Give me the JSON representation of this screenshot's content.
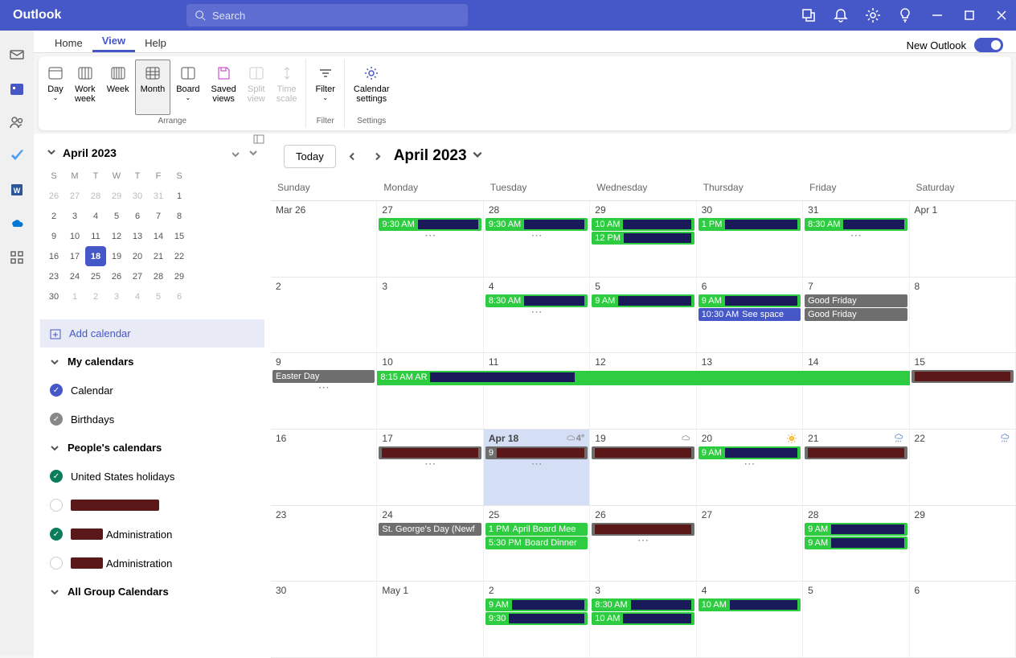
{
  "app": {
    "title": "Outlook"
  },
  "search": {
    "placeholder": "Search"
  },
  "tabs": {
    "home": "Home",
    "view": "View",
    "help": "Help",
    "new_outlook": "New Outlook"
  },
  "ribbon": {
    "day": "Day",
    "work_week": "Work\nweek",
    "week": "Week",
    "month": "Month",
    "board": "Board",
    "saved": "Saved\nviews",
    "split": "Split\nview",
    "timescale": "Time\nscale",
    "filter": "Filter",
    "settings": "Calendar\nsettings",
    "grp_arrange": "Arrange",
    "grp_filter": "Filter",
    "grp_settings": "Settings"
  },
  "toolbar": {
    "today": "Today",
    "title": "April 2023"
  },
  "mini_cal": {
    "title": "April 2023",
    "days": [
      "S",
      "M",
      "T",
      "W",
      "T",
      "F",
      "S"
    ],
    "weeks": [
      [
        {
          "d": "26",
          "o": true
        },
        {
          "d": "27",
          "o": true
        },
        {
          "d": "28",
          "o": true
        },
        {
          "d": "29",
          "o": true
        },
        {
          "d": "30",
          "o": true
        },
        {
          "d": "31",
          "o": true
        },
        {
          "d": "1"
        }
      ],
      [
        {
          "d": "2"
        },
        {
          "d": "3"
        },
        {
          "d": "4"
        },
        {
          "d": "5"
        },
        {
          "d": "6"
        },
        {
          "d": "7"
        },
        {
          "d": "8"
        }
      ],
      [
        {
          "d": "9"
        },
        {
          "d": "10"
        },
        {
          "d": "11"
        },
        {
          "d": "12"
        },
        {
          "d": "13"
        },
        {
          "d": "14"
        },
        {
          "d": "15"
        }
      ],
      [
        {
          "d": "16"
        },
        {
          "d": "17"
        },
        {
          "d": "18",
          "c": true
        },
        {
          "d": "19"
        },
        {
          "d": "20"
        },
        {
          "d": "21"
        },
        {
          "d": "22"
        }
      ],
      [
        {
          "d": "23"
        },
        {
          "d": "24"
        },
        {
          "d": "25"
        },
        {
          "d": "26"
        },
        {
          "d": "27"
        },
        {
          "d": "28"
        },
        {
          "d": "29"
        }
      ],
      [
        {
          "d": "30"
        },
        {
          "d": "1",
          "o": true
        },
        {
          "d": "2",
          "o": true
        },
        {
          "d": "3",
          "o": true
        },
        {
          "d": "4",
          "o": true
        },
        {
          "d": "5",
          "o": true
        },
        {
          "d": "6",
          "o": true
        }
      ]
    ]
  },
  "sidebar": {
    "add": "Add calendar",
    "my": "My calendars",
    "calendar": "Calendar",
    "birthdays": "Birthdays",
    "people": "People's calendars",
    "us_holidays": "United States holidays",
    "admin1": " Administration",
    "admin2": " Administration",
    "groups": "All Group Calendars"
  },
  "day_headers": [
    "Sunday",
    "Monday",
    "Tuesday",
    "Wednesday",
    "Thursday",
    "Friday",
    "Saturday"
  ],
  "weeks": [
    {
      "days": [
        {
          "date": "Mar 26",
          "events": []
        },
        {
          "date": "27",
          "events": [
            {
              "t": "9:30 AM",
              "c": "green",
              "r": true
            }
          ],
          "more": true
        },
        {
          "date": "28",
          "events": [
            {
              "t": "9:30 AM",
              "c": "green",
              "r": true
            }
          ],
          "more": true
        },
        {
          "date": "29",
          "events": [
            {
              "t": "10 AM",
              "c": "green",
              "r": true
            },
            {
              "t": "12 PM",
              "c": "green",
              "r": true
            }
          ]
        },
        {
          "date": "30",
          "events": [
            {
              "t": "1 PM",
              "c": "green",
              "r": true
            }
          ]
        },
        {
          "date": "31",
          "events": [
            {
              "t": "8:30 AM",
              "c": "green",
              "r": true
            }
          ],
          "more": true
        },
        {
          "date": "Apr 1",
          "events": []
        }
      ]
    },
    {
      "days": [
        {
          "date": "2",
          "events": []
        },
        {
          "date": "3",
          "events": []
        },
        {
          "date": "4",
          "events": [
            {
              "t": "8:30 AM",
              "c": "green",
              "r": true
            }
          ],
          "more": true
        },
        {
          "date": "5",
          "events": [
            {
              "t": "9 AM",
              "c": "green",
              "r": true
            }
          ]
        },
        {
          "date": "6",
          "events": [
            {
              "t": "9 AM",
              "c": "green",
              "r": true
            },
            {
              "t": "10:30 AM",
              "c": "blue",
              "label": "See space"
            }
          ]
        },
        {
          "date": "7",
          "events": [
            {
              "c": "gray",
              "label": "Good Friday"
            },
            {
              "c": "gray",
              "label": "Good Friday"
            }
          ]
        },
        {
          "date": "8",
          "events": []
        }
      ]
    },
    {
      "days": [
        {
          "date": "9",
          "events": [
            {
              "c": "gray",
              "label": "Easter Day"
            }
          ],
          "more": true
        },
        {
          "date": "10",
          "events": [],
          "more": true
        },
        {
          "date": "11",
          "events": [],
          "more": true
        },
        {
          "date": "12",
          "events": [],
          "more": true
        },
        {
          "date": "13",
          "events": [],
          "more": true
        },
        {
          "date": "14",
          "events": []
        },
        {
          "date": "15",
          "events": [
            {
              "c": "gray",
              "r": true
            }
          ]
        }
      ],
      "multi": {
        "t": "8:15 AM",
        "label": "AR",
        "c": "green",
        "start": 1,
        "span": 5
      }
    },
    {
      "days": [
        {
          "date": "16",
          "events": []
        },
        {
          "date": "17",
          "events": [
            {
              "c": "gray",
              "r": true
            }
          ],
          "more": true
        },
        {
          "date": "Apr 18",
          "today": true,
          "weather": "4°",
          "wicon": "cloud",
          "events": [
            {
              "t": "9",
              "c": "gray",
              "r": true
            }
          ],
          "more": true
        },
        {
          "date": "19",
          "weather": "",
          "wicon": "cloud",
          "events": [
            {
              "c": "gray",
              "r": true
            }
          ]
        },
        {
          "date": "20",
          "weather": "",
          "wicon": "sun",
          "events": [
            {
              "t": "9 AM",
              "c": "green",
              "r": true
            }
          ],
          "more": true
        },
        {
          "date": "21",
          "weather": "",
          "wicon": "rain",
          "events": [
            {
              "c": "gray",
              "r": true
            }
          ]
        },
        {
          "date": "22",
          "weather": "",
          "wicon": "rain",
          "events": []
        }
      ]
    },
    {
      "days": [
        {
          "date": "23",
          "events": []
        },
        {
          "date": "24",
          "events": [
            {
              "c": "gray",
              "label": "St. George's Day (Newf"
            }
          ]
        },
        {
          "date": "25",
          "events": [
            {
              "t": "1 PM",
              "c": "green",
              "label": "April Board Mee"
            },
            {
              "t": "5:30 PM",
              "c": "green",
              "label": "Board Dinner"
            }
          ]
        },
        {
          "date": "26",
          "events": [
            {
              "t": "",
              "c": "gray",
              "r": true
            }
          ],
          "more": true
        },
        {
          "date": "27",
          "events": []
        },
        {
          "date": "28",
          "events": [
            {
              "t": "9 AM",
              "c": "green",
              "r": true
            },
            {
              "t": "9 AM",
              "c": "green",
              "r": true
            }
          ]
        },
        {
          "date": "29",
          "events": []
        }
      ]
    },
    {
      "days": [
        {
          "date": "30",
          "events": []
        },
        {
          "date": "May 1",
          "events": []
        },
        {
          "date": "2",
          "events": [
            {
              "t": "9 AM",
              "c": "green",
              "r": true
            },
            {
              "t": "9:30",
              "c": "green",
              "r": true
            }
          ]
        },
        {
          "date": "3",
          "events": [
            {
              "t": "8:30 AM",
              "c": "green",
              "r": true
            },
            {
              "t": "10 AM",
              "c": "green",
              "r": true
            }
          ]
        },
        {
          "date": "4",
          "events": [
            {
              "t": "10 AM",
              "c": "green",
              "r": true
            }
          ]
        },
        {
          "date": "5",
          "events": []
        },
        {
          "date": "6",
          "events": []
        }
      ]
    }
  ]
}
